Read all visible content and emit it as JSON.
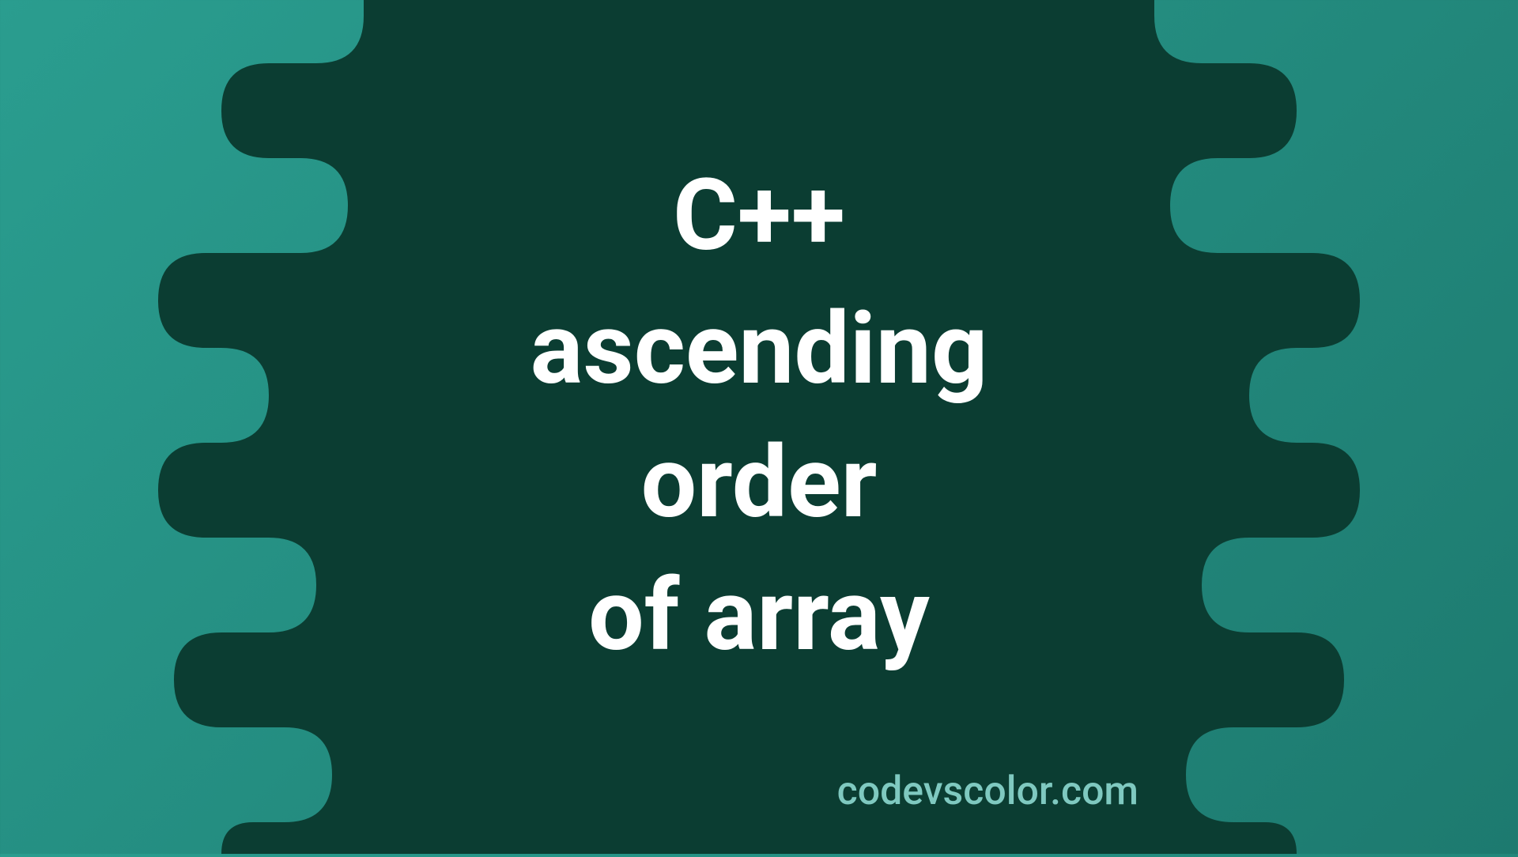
{
  "title": "C++\nascending\norder\nof array",
  "watermark": "codevscolor.com",
  "colors": {
    "bg_light": "#2a9d8f",
    "bg_dark": "#0b3d32",
    "text_main": "#ffffff",
    "text_watermark": "#7fc9c0"
  }
}
